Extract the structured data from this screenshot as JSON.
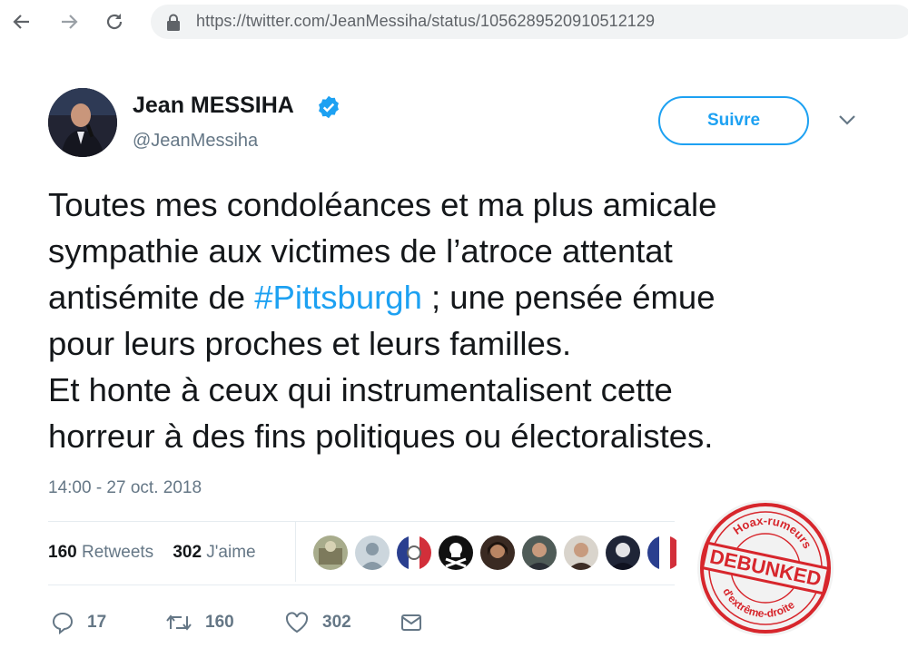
{
  "browser": {
    "url": "https://twitter.com/JeanMessiha/status/1056289520910512129",
    "icons": [
      "back-arrow-icon",
      "forward-arrow-icon",
      "reload-icon",
      "lock-icon"
    ]
  },
  "tweet": {
    "author_name": "Jean MESSIHA",
    "handle": "@JeanMessiha",
    "follow_label": "Suivre",
    "lines": [
      {
        "before": "Toutes mes condoléances et ma plus amicale",
        "tag": "",
        "after": ""
      },
      {
        "before": "sympathie aux victimes de l’atroce attentat",
        "tag": "",
        "after": ""
      },
      {
        "before": "antisémite de ",
        "tag": "#Pittsburgh",
        "after": " ; une pensée émue"
      },
      {
        "before": "pour leurs proches et leurs familles.",
        "tag": "",
        "after": ""
      },
      {
        "before": "Et honte à ceux qui instrumentalisent cette",
        "tag": "",
        "after": ""
      },
      {
        "before": "horreur à des fins politiques ou électoralistes.",
        "tag": "",
        "after": ""
      }
    ],
    "timestamp": "14:00 - 27 oct. 2018",
    "stats": {
      "retweets_count": "160",
      "retweets_label": "Retweets",
      "likes_count": "302",
      "likes_label": "J'aime"
    },
    "actions": {
      "reply_count": "17",
      "retweet_count": "160",
      "like_count": "302"
    }
  },
  "stamp": {
    "top_text": "Hoax-rumeurs",
    "center_text": "DEBUNKED",
    "bottom_text": "d'extrême-droite"
  },
  "colors": {
    "accent": "#1da1f2",
    "text": "#14171a",
    "muted": "#657786",
    "stamp_red": "#d7262c"
  }
}
